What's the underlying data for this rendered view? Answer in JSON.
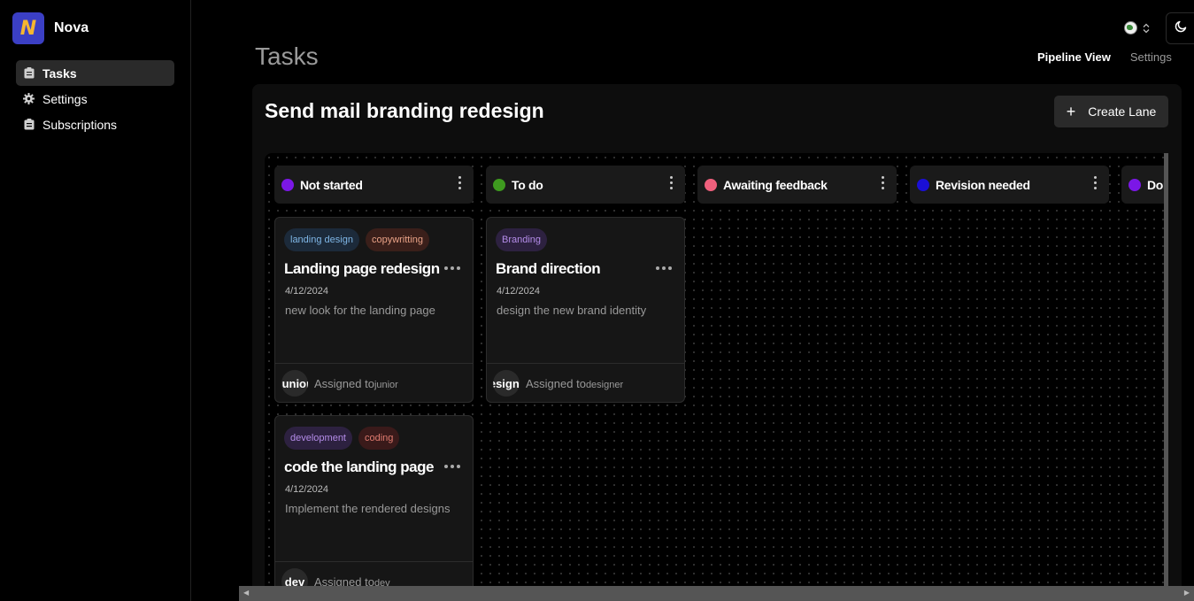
{
  "brand": {
    "logo_letter": "N",
    "name": "Nova"
  },
  "sidebar": {
    "items": [
      {
        "label": "Tasks",
        "icon": "clipboard-icon",
        "active": true
      },
      {
        "label": "Settings",
        "icon": "gear-icon",
        "active": false
      },
      {
        "label": "Subscriptions",
        "icon": "clipboard-icon",
        "active": false
      }
    ]
  },
  "header": {
    "title": "Tasks",
    "tabs": [
      {
        "label": "Pipeline View",
        "active": true
      },
      {
        "label": "Settings",
        "active": false
      }
    ],
    "language_icon": "globe-icon",
    "theme_icon": "moon-icon"
  },
  "pipeline": {
    "title": "Send mail branding redesign",
    "create_lane_label": "Create Lane",
    "lanes": [
      {
        "name": "Not started",
        "color": "#7b17e6"
      },
      {
        "name": "To do",
        "color": "#3e9a1f"
      },
      {
        "name": "Awaiting feedback",
        "color": "#f0607d"
      },
      {
        "name": "Revision needed",
        "color": "#1a0fd6"
      },
      {
        "name": "Don",
        "color": "#7b17e6"
      }
    ],
    "cards": [
      {
        "lane": "Not started",
        "tags": [
          {
            "label": "landing design",
            "bg": "#1c2a3a",
            "color": "#7fb6e6"
          },
          {
            "label": "copywritting",
            "bg": "#3a1f1a",
            "color": "#e9a287"
          }
        ],
        "title": "Landing page redesign",
        "date": "4/12/2024",
        "description": "new look for the landing page",
        "avatar_text": "junior",
        "assigned_prefix": "Assigned to",
        "assignee": "junior"
      },
      {
        "lane": "To do",
        "tags": [
          {
            "label": "Branding",
            "bg": "#2d2140",
            "color": "#b48ce8"
          }
        ],
        "title": "Brand direction",
        "date": "4/12/2024",
        "description": "design the new brand identity",
        "avatar_text": "designer",
        "assigned_prefix": "Assigned to",
        "assignee": "designer"
      },
      {
        "lane": "Not started",
        "tags": [
          {
            "label": "development",
            "bg": "#2d2140",
            "color": "#b48ce8"
          },
          {
            "label": "coding",
            "bg": "#3a1a1a",
            "color": "#e07b6f"
          }
        ],
        "title": "code the landing page",
        "date": "4/12/2024",
        "description": "Implement the rendered designs",
        "avatar_text": "dev",
        "assigned_prefix": "Assigned to",
        "assignee": "dev"
      }
    ]
  }
}
